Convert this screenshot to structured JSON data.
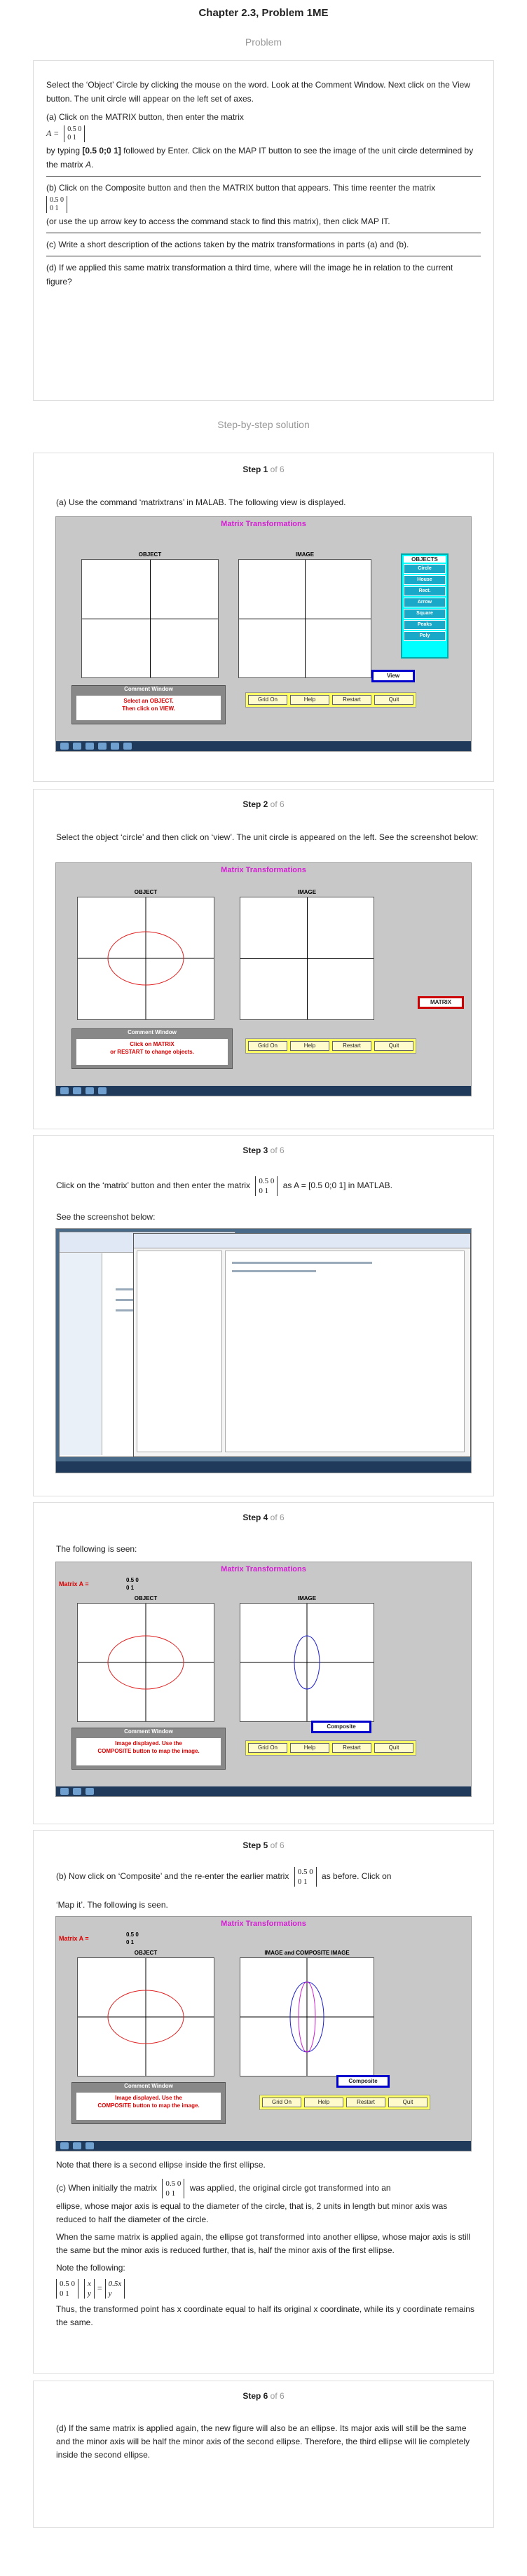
{
  "header": {
    "title": "Chapter 2.3, Problem 1ME",
    "problem_label": "Problem"
  },
  "problem": {
    "p1": "Select the ‘Object’ Circle by clicking the mouse on the word. Look at the Comment Window. Next click on the View button. The unit circle will appear on the left set of axes.",
    "p2": "(a) Click on the MATRIX button, then enter the matrix",
    "matrix_lhs": "A =",
    "matrix_a": [
      "0.5  0",
      "0    1"
    ],
    "p3_pre": "by typing ",
    "p3_bold": "[0.5 0;0 1]",
    "p3_post": " followed by Enter. Click on the MAP IT button to see the image of the unit circle determined by the matrix ",
    "p3_italic": "A",
    "p4": "(b) Click on the Composite button and then the MATRIX button that appears. This time reenter the matrix",
    "p5": "(or use the up arrow key to access the command stack to find this matrix), then click MAP IT.",
    "p6": "(c) Write a short description of the actions taken by the matrix transformations in parts (a) and (b).",
    "p7": "(d) If we applied this same matrix transformation a third time, where will the image he in relation to the current figure?"
  },
  "solution_label": "Step-by-step solution",
  "steps": [
    {
      "title": "Step 1",
      "of": "of 6",
      "text": "(a) Use the command ‘matrixtrans’ in MALAB. The following view is displayed."
    },
    {
      "title": "Step 2",
      "of": "of 6",
      "text": "Select the object ‘circle’ and then click on ‘view’. The unit circle is appeared on the left. See the screenshot below:"
    },
    {
      "title": "Step 3",
      "of": "of 6",
      "text_pre": "Click on the ‘matrix’ button and then enter the matrix",
      "text_post": "as A = [0.5 0;0 1] in MATLAB.",
      "text2": "See the screenshot below:"
    },
    {
      "title": "Step 4",
      "of": "of 6",
      "text": "The following is seen:"
    },
    {
      "title": "Step 5",
      "of": "of 6",
      "text_pre": "(b) Now click on ‘Composite’ and the re-enter the earlier matrix",
      "text_post": "as before. Click on",
      "text_post2": "‘Map it’. The following is seen.",
      "note1": "Note that there is a second ellipse inside the first ellipse.",
      "c_pre": "(c) When initially the matrix",
      "c_post": "was applied, the original circle got transformed into an",
      "c_rest": "ellipse, whose major axis is equal to the diameter of the circle, that is, 2 units in length but minor axis was reduced to half the diameter of the circle.",
      "c2": "When the same matrix is applied again, the ellipse got transformed into another ellipse, whose major axis is still the same but the minor axis is reduced further, that is, half the minor axis of the first ellipse.",
      "note2": "Note the following:",
      "vec_x": "x",
      "vec_y": "y",
      "res_top": "0.5x",
      "res_bot": "y",
      "final": "Thus, the transformed point has x coordinate equal to half its original x coordinate, while its y coordinate remains the same."
    },
    {
      "title": "Step 6",
      "of": "of 6",
      "text": "(d) If the same matrix is applied again, the new figure will also be an ellipse. Its major axis will still be the same and the minor axis will be half the minor axis of the second ellipse. Therefore, the third ellipse will lie completely inside the second ellipse."
    }
  ],
  "matlab": {
    "title": "Matrix Transformations",
    "object_label": "OBJECT",
    "image_label": "IMAGE",
    "image_composite_label": "IMAGE and COMPOSITE IMAGE",
    "comment_title": "Comment Window",
    "comment_1": [
      "Select an OBJECT.",
      "Then click on VIEW."
    ],
    "comment_2": [
      "Click on MATRIX",
      "or RESTART to change objects."
    ],
    "comment_3": [
      "Image displayed. Use the",
      "COMPOSITE button to map the image."
    ],
    "buttons": [
      "Grid On",
      "Help",
      "Restart",
      "Quit"
    ],
    "objects_title": "OBJECTS",
    "objects": [
      "Circle",
      "House",
      "Rect.",
      "Arrow",
      "Square",
      "Peaks",
      "Poly"
    ],
    "view_btn": "View",
    "matrix_btn": "MATRIX",
    "composite_btn": "Composite",
    "matrix_a_label": "Matrix A =",
    "matrix_a_vals": [
      "0.5    0",
      "  0    1"
    ]
  },
  "matrix_vals": {
    "r1": "0.5  0",
    "r2": "0    1"
  },
  "colors": {
    "title_magenta": "#d21fd2",
    "ellipse_red": "#e02020",
    "ellipse_blue": "#2020d0",
    "accent_gray": "#999999"
  }
}
